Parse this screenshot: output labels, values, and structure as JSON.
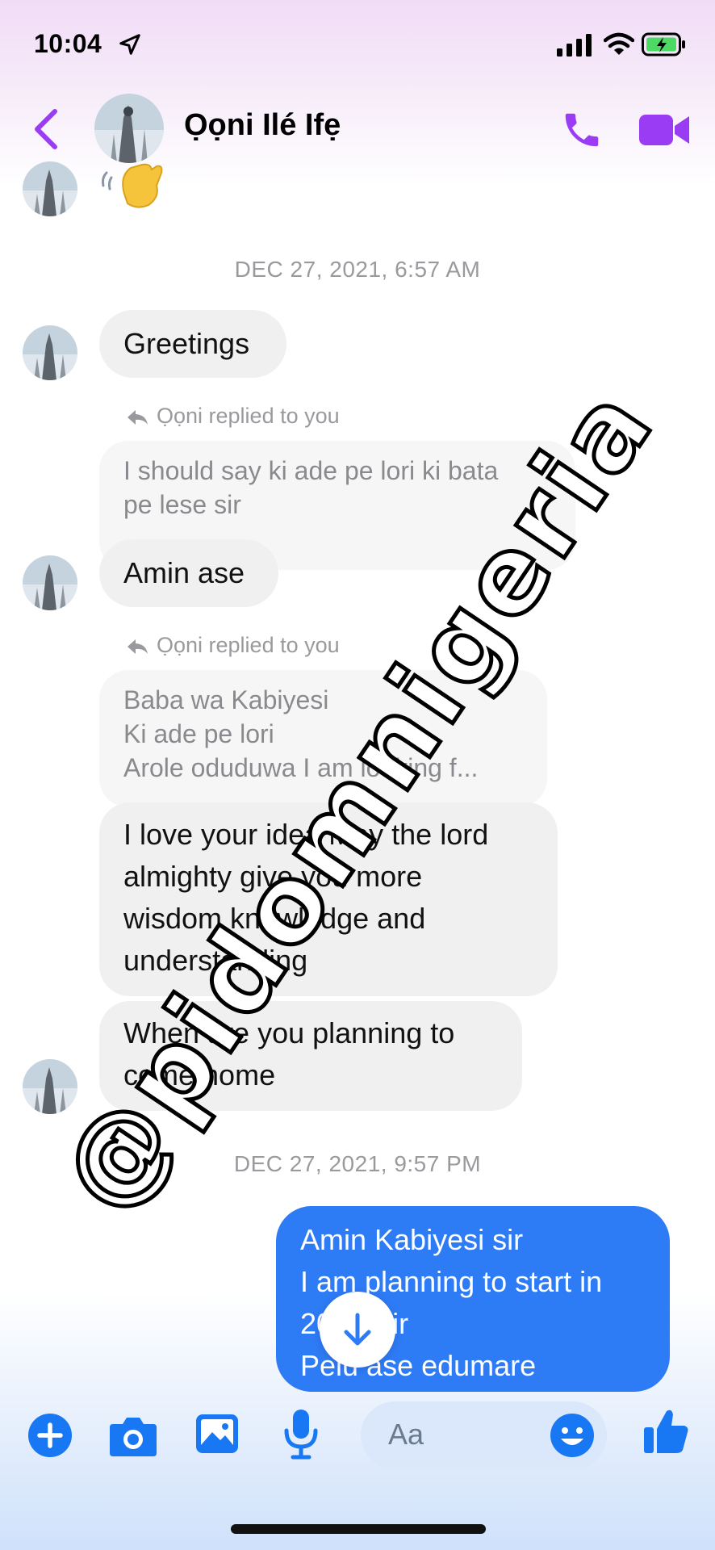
{
  "status_bar": {
    "time": "10:04"
  },
  "header": {
    "contact_name": "Ọọni Ilé Ifẹ"
  },
  "messages": {
    "wave_emoji": "👋",
    "stamp_1": "DEC 27, 2021, 6:57 AM",
    "greeting": "Greetings",
    "reply_label": "Ọọni replied to you",
    "quote_1": [
      "I should say ki ade pe lori ki bata",
      "pe lese sir"
    ],
    "msg_amin": "Amin ase",
    "quote_2": [
      "Baba wa Kabiyesi",
      "Ki ade pe lori",
      "Arole oduduwa I am looking f..."
    ],
    "msg_love": [
      "I love your idea May the lord",
      "almighty give you more",
      "wisdom knowledge and",
      "understanding"
    ],
    "msg_when": [
      "When are you planning to",
      "come home"
    ],
    "stamp_2": "DEC 27, 2021, 9:57 PM",
    "outgoing": [
      "Amin Kabiyesi sir",
      "I am planning to start in",
      "2022 Sir",
      "Pelu ase edumare"
    ]
  },
  "composer": {
    "placeholder": "Aa"
  },
  "watermark": "@pidomnigeria",
  "colors": {
    "accent_purple": "#9b3cf5",
    "messenger_blue": "#2e7bf6",
    "icon_blue": "#1877f2"
  }
}
